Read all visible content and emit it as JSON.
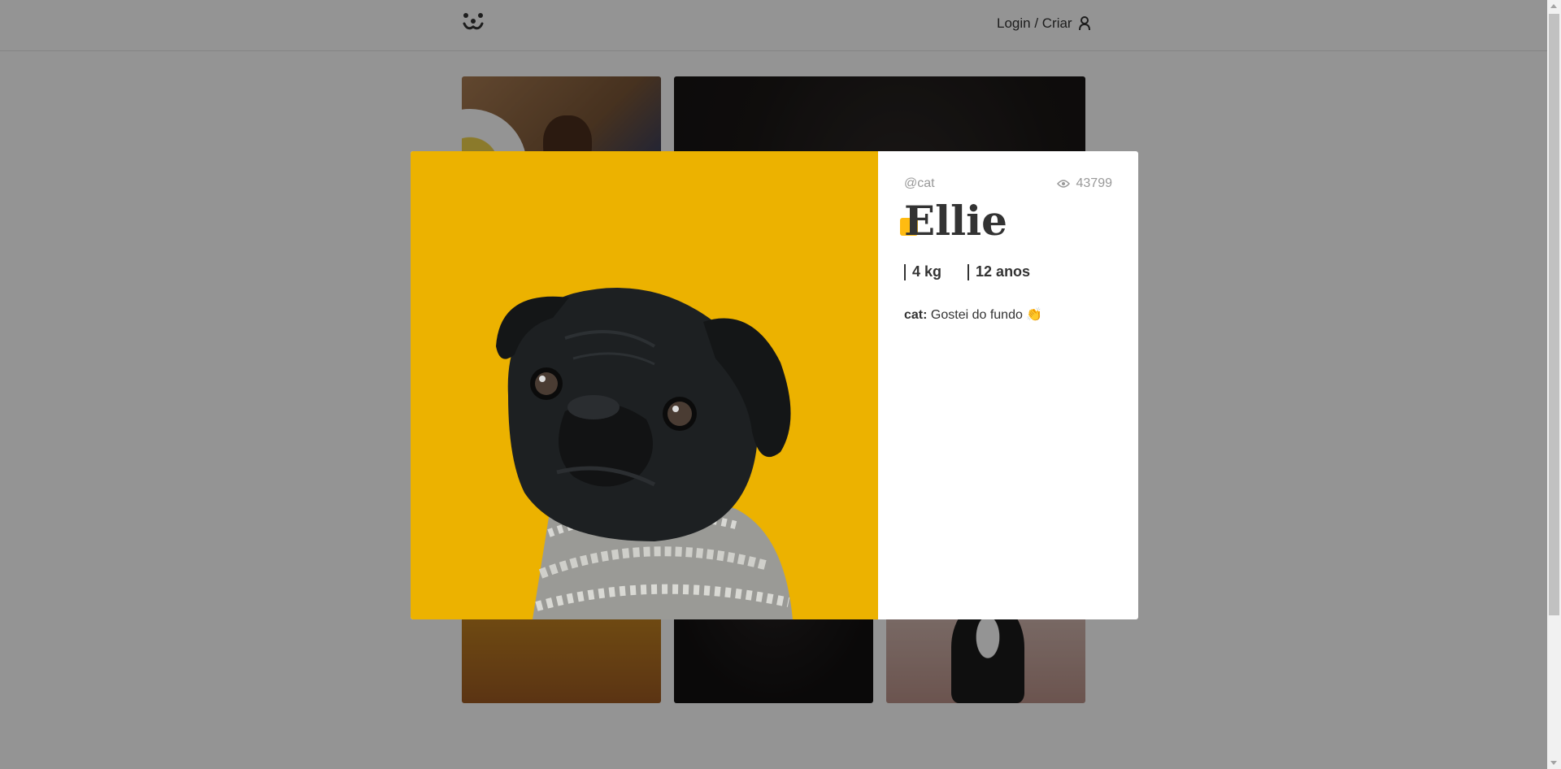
{
  "header": {
    "login_label": "Login / Criar"
  },
  "modal": {
    "author": "@cat",
    "views": "43799",
    "pet_name": "Ellie",
    "attributes": [
      "4 kg",
      "12 anos"
    ],
    "comments": [
      {
        "author": "cat:",
        "text": "Gostei do fundo 👏"
      }
    ]
  },
  "colors": {
    "accent": "#ffbb11",
    "photo_background": "#ecb200",
    "overlay": "rgba(0,0,0,0.42)"
  }
}
